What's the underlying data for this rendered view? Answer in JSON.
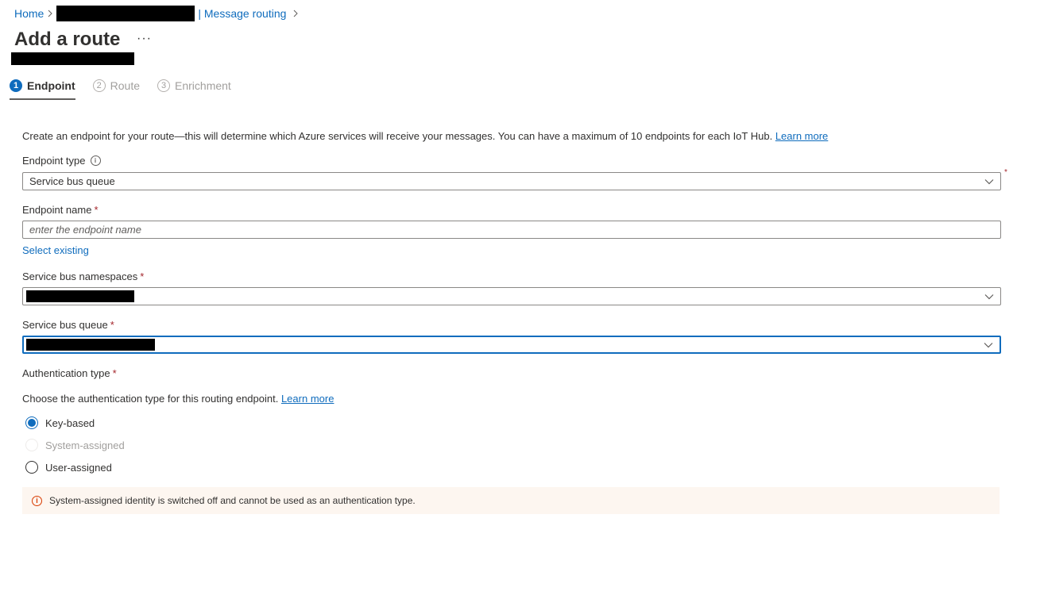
{
  "breadcrumb": {
    "home": "Home",
    "message_routing": "| Message routing"
  },
  "page": {
    "title": "Add a route",
    "more": "···"
  },
  "steps": [
    {
      "num": "1",
      "label": "Endpoint"
    },
    {
      "num": "2",
      "label": "Route"
    },
    {
      "num": "3",
      "label": "Enrichment"
    }
  ],
  "form": {
    "description": "Create an endpoint for your route—this will determine which Azure services will receive your messages. You can have a maximum of 10 endpoints for each IoT Hub.",
    "description_link": "Learn more",
    "endpoint_type": {
      "label": "Endpoint type",
      "value": "Service bus queue"
    },
    "endpoint_name": {
      "label": "Endpoint name",
      "placeholder": "enter the endpoint name"
    },
    "select_existing": "Select existing",
    "namespaces": {
      "label": "Service bus namespaces"
    },
    "queue": {
      "label": "Service bus queue"
    },
    "auth": {
      "label": "Authentication type",
      "description": "Choose the authentication type for this routing endpoint.",
      "link": "Learn more",
      "options": [
        "Key-based",
        "System-assigned",
        "User-assigned"
      ],
      "selected": "Key-based"
    },
    "required_mark": "*"
  },
  "warning": {
    "text": "System-assigned identity is switched off and cannot be used as an authentication type."
  },
  "colors": {
    "accent": "#0f6cbd",
    "required": "#a4262c",
    "warning_bg": "#fdf6f0",
    "warning_icon": "#d83b01"
  }
}
